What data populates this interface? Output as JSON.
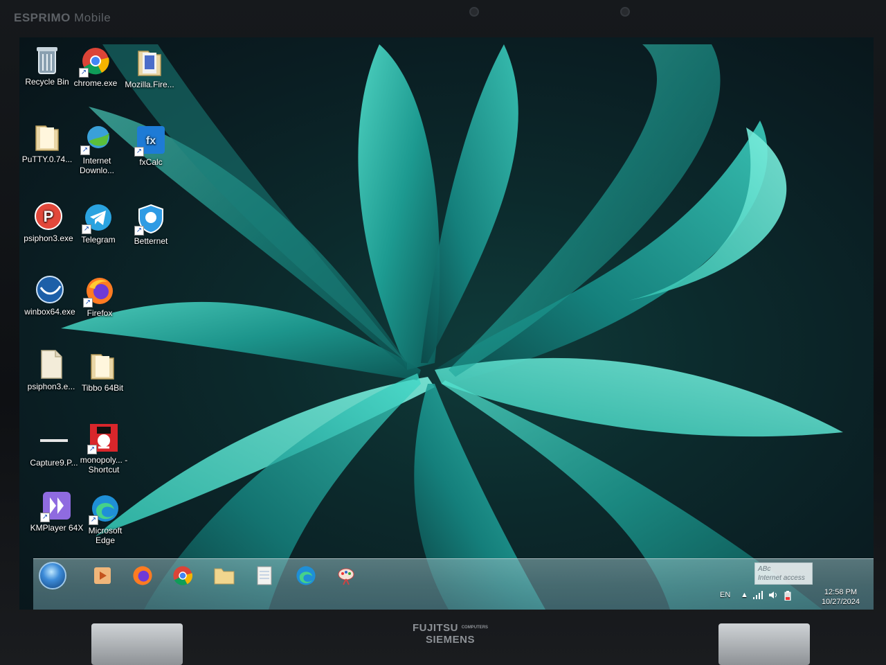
{
  "bezel": {
    "brand_top_bold": "ESPRIMO",
    "brand_top_light": "Mobile",
    "brand_bottom_line1": "FUJITSU",
    "brand_bottom_small": "COMPUTERS",
    "brand_bottom_line2": "SIEMENS"
  },
  "desktop": {
    "icons": [
      {
        "id": "recycle-bin",
        "label": "Recycle Bin",
        "icon": "recycle-bin-icon",
        "shortcut": false
      },
      {
        "id": "chrome",
        "label": "chrome.exe",
        "icon": "chrome-icon",
        "shortcut": true
      },
      {
        "id": "mozilla",
        "label": "Mozilla.Fire...",
        "icon": "folder-icon",
        "shortcut": false
      },
      {
        "id": "putty",
        "label": "PuTTY.0.74...",
        "icon": "folder-icon",
        "shortcut": false
      },
      {
        "id": "idm",
        "label": "Internet Downlo...",
        "icon": "internet-download-manager-icon",
        "shortcut": true
      },
      {
        "id": "fxcalc",
        "label": "fxCalc",
        "icon": "fxcalc-icon",
        "shortcut": true
      },
      {
        "id": "psiphon",
        "label": "psiphon3.exe",
        "icon": "psiphon-icon",
        "shortcut": false
      },
      {
        "id": "telegram",
        "label": "Telegram",
        "icon": "telegram-icon",
        "shortcut": true
      },
      {
        "id": "betternet",
        "label": "Betternet",
        "icon": "betternet-icon",
        "shortcut": true
      },
      {
        "id": "winbox",
        "label": "winbox64.exe",
        "icon": "winbox-icon",
        "shortcut": false
      },
      {
        "id": "firefox",
        "label": "Firefox",
        "icon": "firefox-icon",
        "shortcut": true
      },
      {
        "id": "psiphon-file",
        "label": "psiphon3.e...",
        "icon": "file-icon",
        "shortcut": false
      },
      {
        "id": "tibbo",
        "label": "Tibbo 64Bit",
        "icon": "folder-icon",
        "shortcut": false
      },
      {
        "id": "capture",
        "label": "Capture9.P...",
        "icon": "image-file-icon",
        "shortcut": false
      },
      {
        "id": "monopoly",
        "label": "monopoly... - Shortcut",
        "icon": "monopoly-icon",
        "shortcut": true
      },
      {
        "id": "kmplayer",
        "label": "KMPlayer 64X",
        "icon": "kmplayer-icon",
        "shortcut": true
      },
      {
        "id": "edge",
        "label": "Microsoft Edge",
        "icon": "edge-icon",
        "shortcut": true
      }
    ]
  },
  "taskbar": {
    "pinned": [
      {
        "id": "start",
        "icon": "windows-start-icon"
      },
      {
        "id": "media-player",
        "icon": "media-player-icon"
      },
      {
        "id": "firefox",
        "icon": "firefox-icon"
      },
      {
        "id": "chrome",
        "icon": "chrome-icon"
      },
      {
        "id": "explorer",
        "icon": "file-explorer-icon"
      },
      {
        "id": "notepad",
        "icon": "notepad-icon"
      },
      {
        "id": "edge",
        "icon": "edge-icon"
      },
      {
        "id": "paint",
        "icon": "paint-icon"
      }
    ],
    "tray": {
      "language": "EN",
      "show_hidden_arrow": "▲",
      "time": "12:58 PM",
      "date": "10/27/2024"
    },
    "network_tooltip": {
      "line1": "ABc",
      "line2": "Internet access"
    }
  },
  "colors": {
    "wallpaper_leaf_light": "#3fd9c8",
    "wallpaper_leaf_mid": "#1e9e97",
    "wallpaper_dark": "#0a1d22"
  }
}
